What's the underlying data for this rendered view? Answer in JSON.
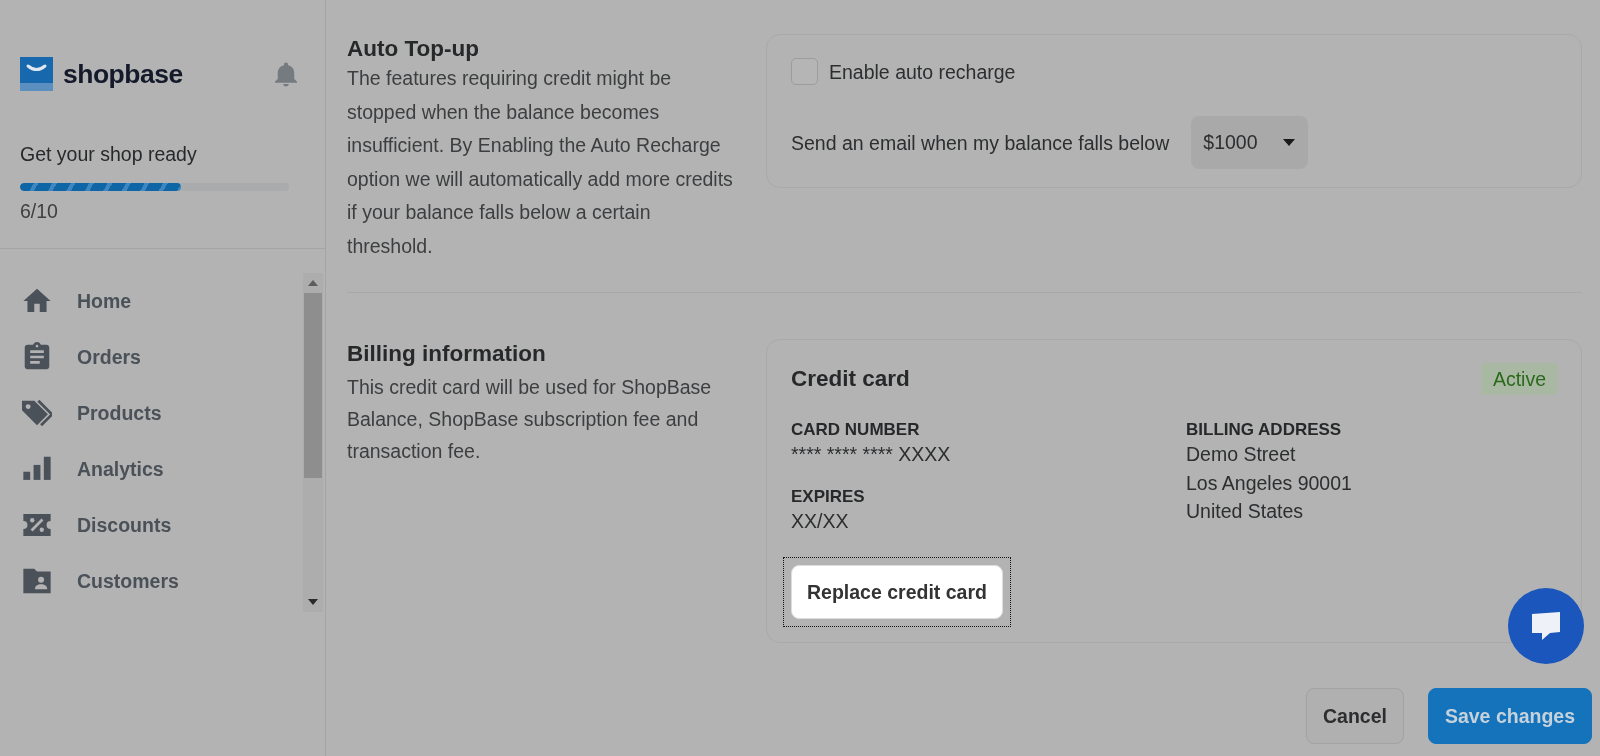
{
  "sidebar": {
    "logo_text": "shopbase",
    "setup": {
      "title": "Get your shop ready",
      "level": 0.6,
      "progress": "6/10"
    },
    "nav_items": [
      {
        "label": "Home",
        "selected": false
      },
      {
        "label": "Orders",
        "selected": false
      },
      {
        "label": "Products",
        "selected": false
      },
      {
        "label": "Analytics",
        "selected": false
      },
      {
        "label": "Discounts",
        "selected": false
      },
      {
        "label": "Customers",
        "selected": false
      }
    ]
  },
  "auto_topup": {
    "title": "Auto Top-up",
    "description": "The features requiring credit might be stopped when the balance becomes insufficient. By Enabling the Auto Recharge option we will automatically add more credits if your balance falls below a certain threshold.",
    "enable_checkbox": {
      "label": "Enable auto recharge",
      "checked": false
    },
    "threshold": {
      "label": "Send an email when my balance falls below",
      "value": "$1000"
    }
  },
  "billing": {
    "title": "Billing information",
    "description": "This credit card will be used for ShopBase Balance, ShopBase subscription fee and transaction fee.",
    "card": {
      "title": "Credit card",
      "status": {
        "label": "Active",
        "kind": "success"
      },
      "fields": [
        {
          "label": "CARD NUMBER",
          "value": "**** **** **** XXXX"
        },
        {
          "label": "EXPIRES",
          "value": "XX/XX"
        }
      ],
      "address": {
        "label": "BILLING ADDRESS",
        "lines": [
          "Demo Street",
          "Los Angeles 90001",
          "United States"
        ]
      },
      "replace_button": {
        "label": "Replace credit card",
        "focused": true
      }
    }
  },
  "footer_buttons": [
    {
      "label": "Cancel",
      "kind": "secondary"
    },
    {
      "label": "Save changes",
      "kind": "primary"
    }
  ]
}
